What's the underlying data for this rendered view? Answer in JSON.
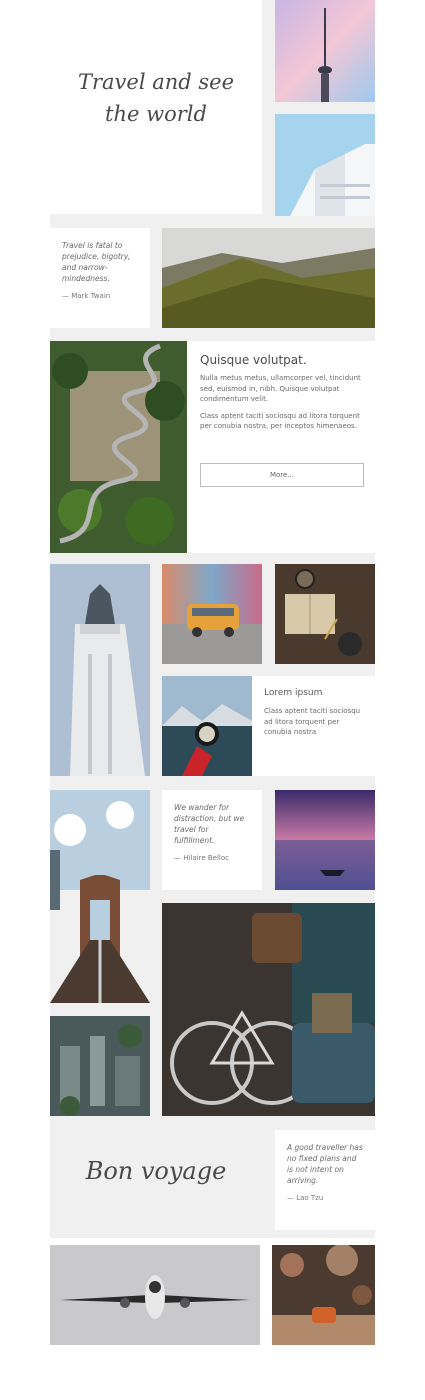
{
  "hero": {
    "title_line1": "Travel and see",
    "title_line2": "the world"
  },
  "quote1": {
    "text": "Travel is fatal to prejudice, bigotry, and narrow-mindedness.",
    "author": "— Mark Twain"
  },
  "article": {
    "heading": "Quisque volutpat.",
    "para1": "Nulla metus metus, ullamcorper vel, tincidunt sed, euismod in, nibh. Quisque volutpat condimentum velit.",
    "para2": "Class aptent taciti sociosqu ad litora torquent per conubia nostra, per inceptos himenaeos.",
    "more_label": "More..."
  },
  "lorem": {
    "heading": "Lorem ipsum",
    "text": "Class aptent taciti sociosqu ad litora torquent per conubia nostra"
  },
  "quote2": {
    "text": "We wander for distraction, but we travel for fulfillment.",
    "author": "— Hilaire Belloc"
  },
  "quote3": {
    "text": "A good traveller has no fixed plans and is not intent on arriving.",
    "author": "— Lao Tzu"
  },
  "bon_voyage": {
    "text": "Bon voyage"
  }
}
